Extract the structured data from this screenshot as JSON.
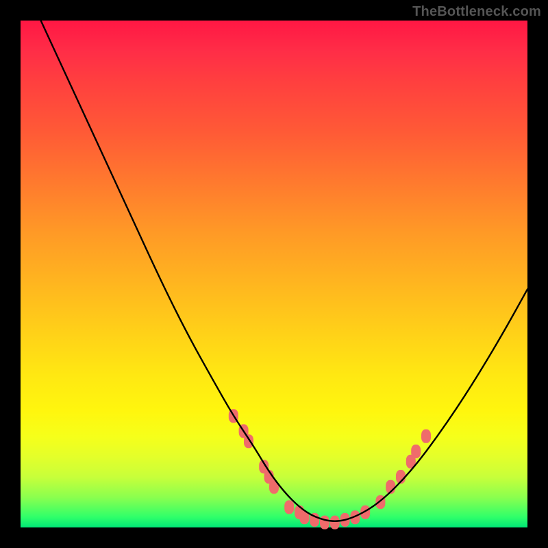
{
  "attribution": "TheBottleneck.com",
  "chart_data": {
    "type": "line",
    "title": "",
    "xlabel": "",
    "ylabel": "",
    "xlim": [
      0,
      100
    ],
    "ylim": [
      0,
      100
    ],
    "grid": false,
    "legend": false,
    "background_gradient": {
      "orientation": "vertical",
      "stops": [
        {
          "pos": 0.0,
          "color": "#ff1744"
        },
        {
          "pos": 0.5,
          "color": "#ffb000"
        },
        {
          "pos": 0.8,
          "color": "#fff200"
        },
        {
          "pos": 1.0,
          "color": "#00e676"
        }
      ]
    },
    "series": [
      {
        "name": "bottleneck-curve",
        "color": "#000000",
        "x": [
          4,
          10,
          16,
          22,
          28,
          33,
          38,
          42,
          46,
          49,
          52,
          55,
          58,
          62,
          66,
          71,
          77,
          83,
          89,
          95,
          100
        ],
        "y": [
          100,
          87,
          74,
          61,
          48,
          38,
          29,
          22,
          16,
          11,
          7,
          4,
          2,
          1,
          2,
          5,
          11,
          19,
          28,
          38,
          47
        ]
      }
    ],
    "markers": {
      "name": "highlighted-points",
      "shape": "rounded-rect",
      "color": "#ef6b6b",
      "points": [
        {
          "x": 42,
          "y": 22
        },
        {
          "x": 44,
          "y": 19
        },
        {
          "x": 45,
          "y": 17
        },
        {
          "x": 48,
          "y": 12
        },
        {
          "x": 49,
          "y": 10
        },
        {
          "x": 50,
          "y": 8
        },
        {
          "x": 53,
          "y": 4
        },
        {
          "x": 55,
          "y": 3
        },
        {
          "x": 56,
          "y": 2
        },
        {
          "x": 58,
          "y": 1.5
        },
        {
          "x": 60,
          "y": 1
        },
        {
          "x": 62,
          "y": 1
        },
        {
          "x": 64,
          "y": 1.5
        },
        {
          "x": 66,
          "y": 2
        },
        {
          "x": 68,
          "y": 3
        },
        {
          "x": 71,
          "y": 5
        },
        {
          "x": 73,
          "y": 8
        },
        {
          "x": 75,
          "y": 10
        },
        {
          "x": 77,
          "y": 13
        },
        {
          "x": 78,
          "y": 15
        },
        {
          "x": 80,
          "y": 18
        }
      ]
    }
  }
}
